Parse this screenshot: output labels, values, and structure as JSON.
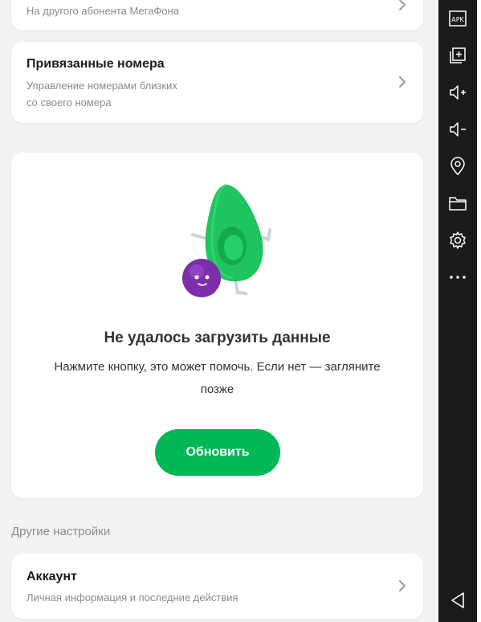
{
  "top_card": {
    "subtitle": "На другого абонента МегаФона"
  },
  "linked_numbers": {
    "title": "Привязанные номера",
    "subtitle_line1": "Управление номерами близких",
    "subtitle_line2": "со своего номера"
  },
  "error": {
    "title": "Не удалось загрузить данные",
    "text": "Нажмите кнопку, это может помочь. Если нет — загляните позже",
    "button_label": "Обновить"
  },
  "other_settings": {
    "section_label": "Другие настройки",
    "account_title": "Аккаунт",
    "account_subtitle": "Личная информация и последние действия"
  },
  "emulator_sidebar": {
    "apk_label": "APK",
    "icons": [
      "apk-icon",
      "add-window-icon",
      "volume-up-icon",
      "volume-down-icon",
      "location-icon",
      "folder-icon",
      "settings-icon",
      "more-icon",
      "back-icon"
    ]
  },
  "colors": {
    "accent": "#00b956",
    "background": "#f2f3f5",
    "sidebar": "#1a1a1a"
  }
}
